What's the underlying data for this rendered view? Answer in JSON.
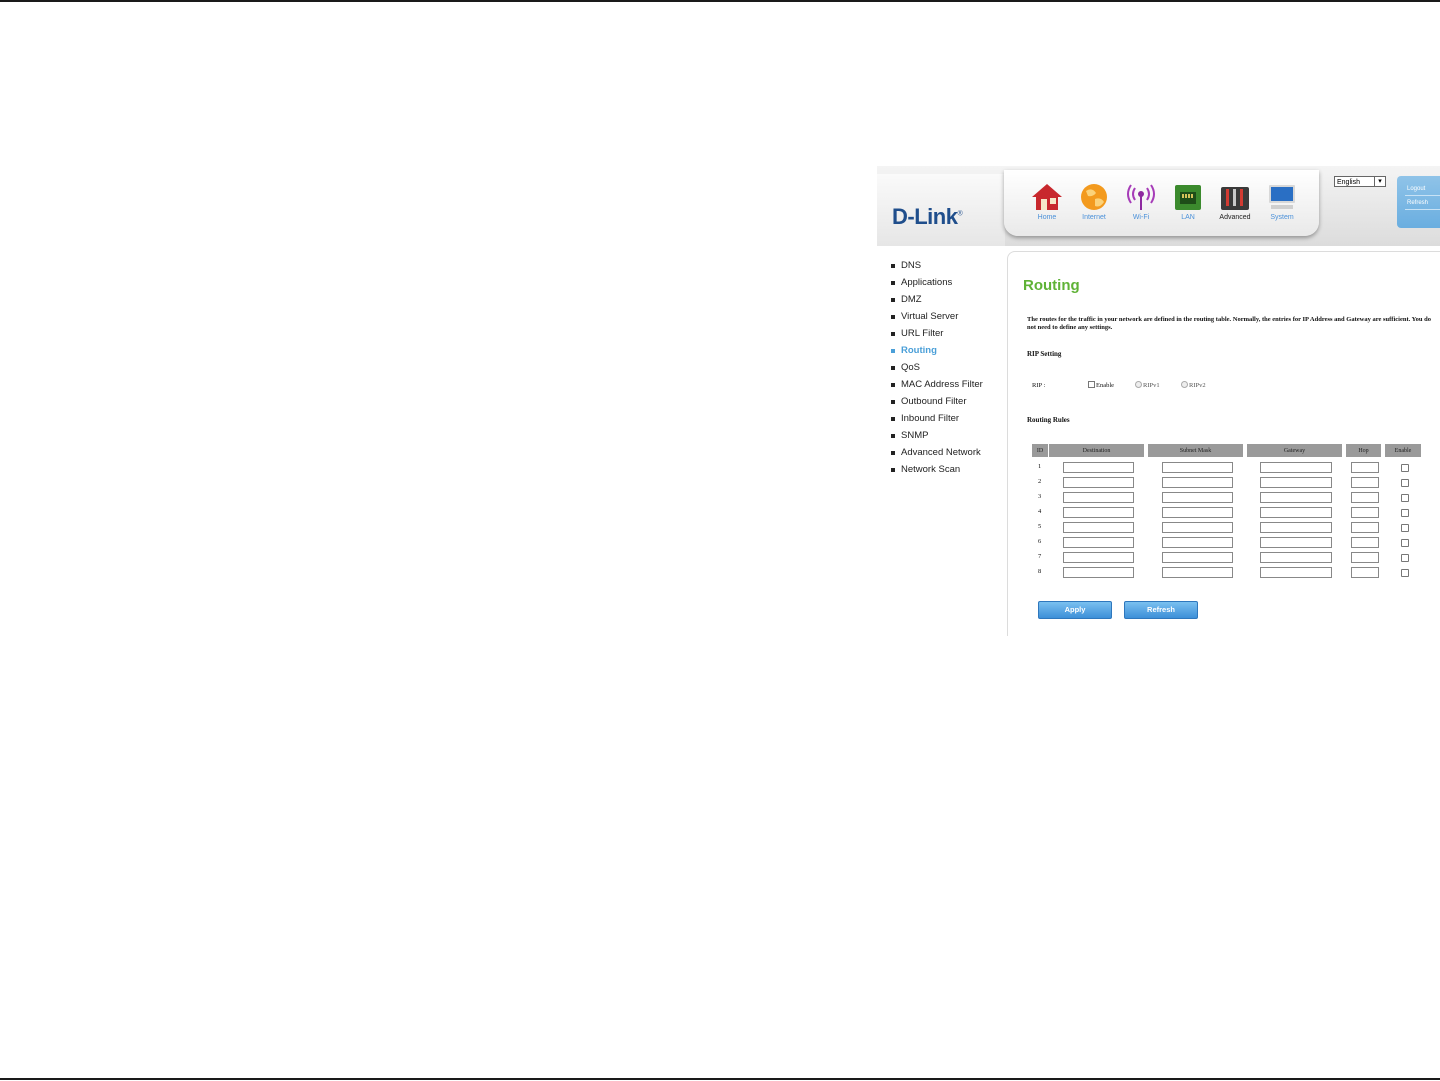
{
  "header": {
    "brand": "D-Link",
    "nav": [
      {
        "label": "Home",
        "icon": "home-icon"
      },
      {
        "label": "Internet",
        "icon": "globe-icon"
      },
      {
        "label": "Wi-Fi",
        "icon": "wifi-antenna-icon"
      },
      {
        "label": "LAN",
        "icon": "lan-port-icon"
      },
      {
        "label": "Advanced",
        "icon": "tools-icon"
      },
      {
        "label": "System",
        "icon": "monitor-icon"
      }
    ],
    "active_nav": "Advanced",
    "language": "English",
    "side_links": [
      "Logout",
      "Refresh"
    ]
  },
  "menu": {
    "items": [
      "DNS",
      "Applications",
      "DMZ",
      "Virtual Server",
      "URL Filter",
      "Routing",
      "QoS",
      "MAC Address Filter",
      "Outbound Filter",
      "Inbound Filter",
      "SNMP",
      "Advanced Network",
      "Network Scan"
    ],
    "active": "Routing"
  },
  "page": {
    "title": "Routing",
    "description": "The routes for the traffic in your network are defined in the routing table. Normally, the entries for IP Address and Gateway are sufficient. You do not need to define any settings.",
    "rip_section": "RIP Setting",
    "rip_label": "RIP :",
    "rip_enable": "Enable",
    "rip_v1": "RIPv1",
    "rip_v2": "RIPv2",
    "rules_section": "Routing Rules",
    "columns": [
      "ID",
      "Destination",
      "Subnet Mask",
      "Gateway",
      "Hop",
      "Enable"
    ],
    "rows": [
      "1",
      "2",
      "3",
      "4",
      "5",
      "6",
      "7",
      "8"
    ],
    "apply_label": "Apply",
    "refresh_label": "Refresh"
  },
  "colors": {
    "title_green": "#5fb236",
    "link_blue": "#4a9fd8",
    "brand_blue": "#1f4e8c",
    "button_blue": "#3d8fd8"
  }
}
